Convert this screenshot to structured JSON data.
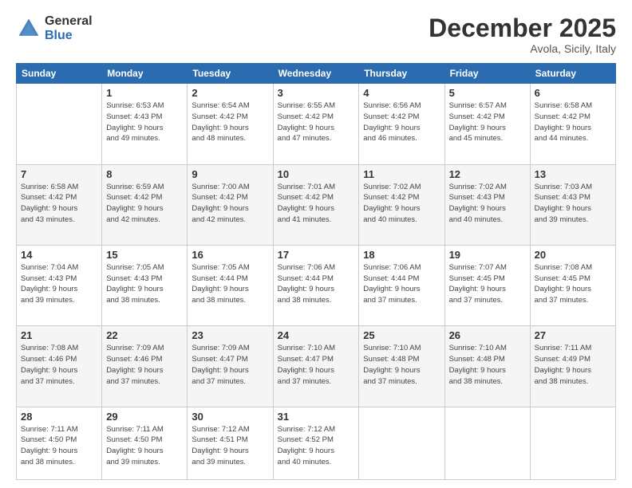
{
  "logo": {
    "general": "General",
    "blue": "Blue"
  },
  "header": {
    "month": "December 2025",
    "location": "Avola, Sicily, Italy"
  },
  "weekdays": [
    "Sunday",
    "Monday",
    "Tuesday",
    "Wednesday",
    "Thursday",
    "Friday",
    "Saturday"
  ],
  "weeks": [
    [
      {
        "day": "",
        "info": ""
      },
      {
        "day": "1",
        "info": "Sunrise: 6:53 AM\nSunset: 4:43 PM\nDaylight: 9 hours\nand 49 minutes."
      },
      {
        "day": "2",
        "info": "Sunrise: 6:54 AM\nSunset: 4:42 PM\nDaylight: 9 hours\nand 48 minutes."
      },
      {
        "day": "3",
        "info": "Sunrise: 6:55 AM\nSunset: 4:42 PM\nDaylight: 9 hours\nand 47 minutes."
      },
      {
        "day": "4",
        "info": "Sunrise: 6:56 AM\nSunset: 4:42 PM\nDaylight: 9 hours\nand 46 minutes."
      },
      {
        "day": "5",
        "info": "Sunrise: 6:57 AM\nSunset: 4:42 PM\nDaylight: 9 hours\nand 45 minutes."
      },
      {
        "day": "6",
        "info": "Sunrise: 6:58 AM\nSunset: 4:42 PM\nDaylight: 9 hours\nand 44 minutes."
      }
    ],
    [
      {
        "day": "7",
        "info": "Sunrise: 6:58 AM\nSunset: 4:42 PM\nDaylight: 9 hours\nand 43 minutes."
      },
      {
        "day": "8",
        "info": "Sunrise: 6:59 AM\nSunset: 4:42 PM\nDaylight: 9 hours\nand 42 minutes."
      },
      {
        "day": "9",
        "info": "Sunrise: 7:00 AM\nSunset: 4:42 PM\nDaylight: 9 hours\nand 42 minutes."
      },
      {
        "day": "10",
        "info": "Sunrise: 7:01 AM\nSunset: 4:42 PM\nDaylight: 9 hours\nand 41 minutes."
      },
      {
        "day": "11",
        "info": "Sunrise: 7:02 AM\nSunset: 4:42 PM\nDaylight: 9 hours\nand 40 minutes."
      },
      {
        "day": "12",
        "info": "Sunrise: 7:02 AM\nSunset: 4:43 PM\nDaylight: 9 hours\nand 40 minutes."
      },
      {
        "day": "13",
        "info": "Sunrise: 7:03 AM\nSunset: 4:43 PM\nDaylight: 9 hours\nand 39 minutes."
      }
    ],
    [
      {
        "day": "14",
        "info": "Sunrise: 7:04 AM\nSunset: 4:43 PM\nDaylight: 9 hours\nand 39 minutes."
      },
      {
        "day": "15",
        "info": "Sunrise: 7:05 AM\nSunset: 4:43 PM\nDaylight: 9 hours\nand 38 minutes."
      },
      {
        "day": "16",
        "info": "Sunrise: 7:05 AM\nSunset: 4:44 PM\nDaylight: 9 hours\nand 38 minutes."
      },
      {
        "day": "17",
        "info": "Sunrise: 7:06 AM\nSunset: 4:44 PM\nDaylight: 9 hours\nand 38 minutes."
      },
      {
        "day": "18",
        "info": "Sunrise: 7:06 AM\nSunset: 4:44 PM\nDaylight: 9 hours\nand 37 minutes."
      },
      {
        "day": "19",
        "info": "Sunrise: 7:07 AM\nSunset: 4:45 PM\nDaylight: 9 hours\nand 37 minutes."
      },
      {
        "day": "20",
        "info": "Sunrise: 7:08 AM\nSunset: 4:45 PM\nDaylight: 9 hours\nand 37 minutes."
      }
    ],
    [
      {
        "day": "21",
        "info": "Sunrise: 7:08 AM\nSunset: 4:46 PM\nDaylight: 9 hours\nand 37 minutes."
      },
      {
        "day": "22",
        "info": "Sunrise: 7:09 AM\nSunset: 4:46 PM\nDaylight: 9 hours\nand 37 minutes."
      },
      {
        "day": "23",
        "info": "Sunrise: 7:09 AM\nSunset: 4:47 PM\nDaylight: 9 hours\nand 37 minutes."
      },
      {
        "day": "24",
        "info": "Sunrise: 7:10 AM\nSunset: 4:47 PM\nDaylight: 9 hours\nand 37 minutes."
      },
      {
        "day": "25",
        "info": "Sunrise: 7:10 AM\nSunset: 4:48 PM\nDaylight: 9 hours\nand 37 minutes."
      },
      {
        "day": "26",
        "info": "Sunrise: 7:10 AM\nSunset: 4:48 PM\nDaylight: 9 hours\nand 38 minutes."
      },
      {
        "day": "27",
        "info": "Sunrise: 7:11 AM\nSunset: 4:49 PM\nDaylight: 9 hours\nand 38 minutes."
      }
    ],
    [
      {
        "day": "28",
        "info": "Sunrise: 7:11 AM\nSunset: 4:50 PM\nDaylight: 9 hours\nand 38 minutes."
      },
      {
        "day": "29",
        "info": "Sunrise: 7:11 AM\nSunset: 4:50 PM\nDaylight: 9 hours\nand 39 minutes."
      },
      {
        "day": "30",
        "info": "Sunrise: 7:12 AM\nSunset: 4:51 PM\nDaylight: 9 hours\nand 39 minutes."
      },
      {
        "day": "31",
        "info": "Sunrise: 7:12 AM\nSunset: 4:52 PM\nDaylight: 9 hours\nand 40 minutes."
      },
      {
        "day": "",
        "info": ""
      },
      {
        "day": "",
        "info": ""
      },
      {
        "day": "",
        "info": ""
      }
    ]
  ]
}
